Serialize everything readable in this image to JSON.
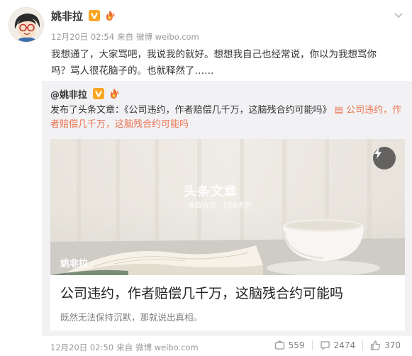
{
  "post": {
    "author": "姚非拉",
    "time": "12月20日 02:54",
    "via": "来自",
    "source": "微博 weibo.com",
    "text": "我想通了，大家骂吧，我说我的就好。想想我自己也经常说，你以为我想骂你吗？骂人很花脑子的。也就释然了……"
  },
  "repost": {
    "author": "@姚非拉",
    "text_prefix": "发布了头条文章：《公司违约，作者赔偿几千万，这脑残合约可能吗》",
    "link_text": "公司违约，作者赔偿几千万，这脑残合约可能吗",
    "card": {
      "watermark_title": "头条文章",
      "watermark_sub": "收藏价值，回味无穷",
      "cover_author": "姚非拉",
      "title": "公司违约，作者赔偿几千万，这脑残合约可能吗",
      "subtitle": "既然无法保持沉默，那就说出真相。"
    },
    "time": "12月20日 02:50",
    "via": "来自",
    "source": "微博 weibo.com",
    "stats": {
      "reposts": "559",
      "comments": "2474",
      "likes": "370"
    }
  },
  "colors": {
    "link": "#eb7350",
    "vip_badge": "#f9a623",
    "repost_bg": "#f2f2f5"
  },
  "icons": [
    "verified-v-icon",
    "fire-level-icon",
    "chevron-down-icon",
    "flash-icon",
    "repost-icon",
    "comment-icon",
    "like-icon"
  ]
}
